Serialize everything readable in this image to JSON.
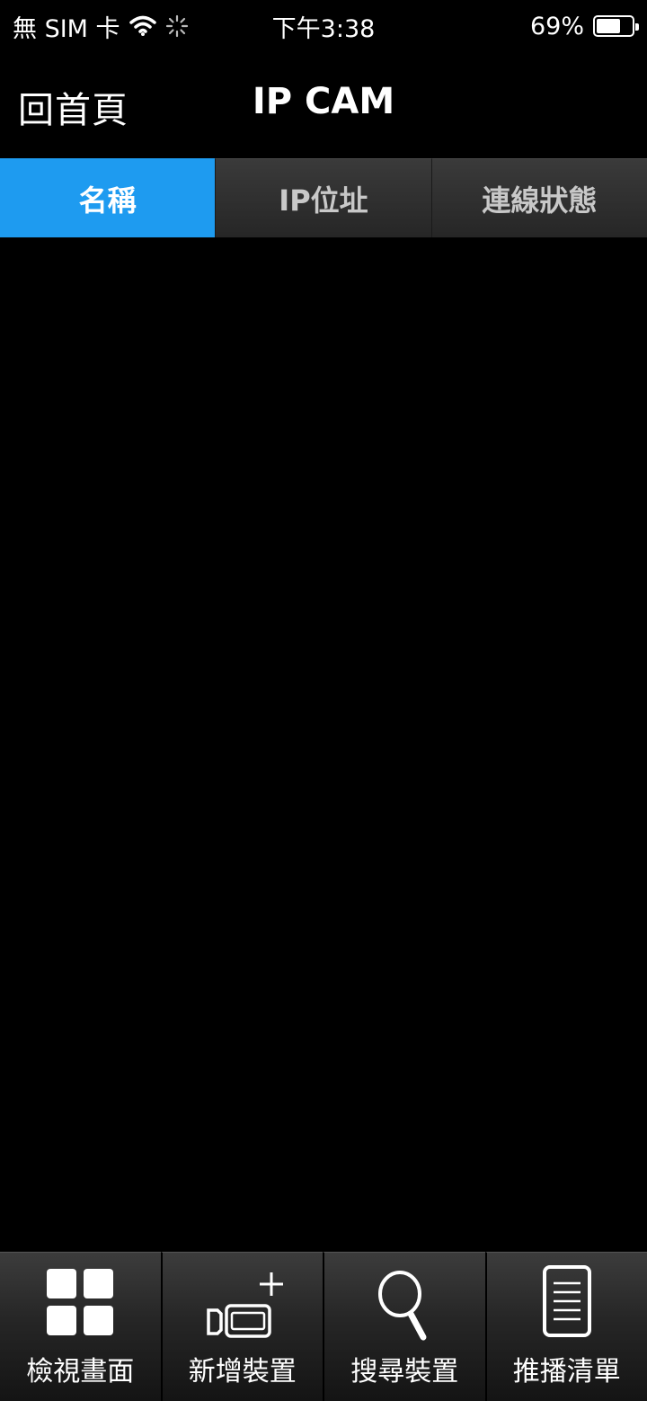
{
  "status_bar": {
    "carrier": "無 SIM 卡",
    "time": "下午3:38",
    "battery_text": "69%",
    "battery_level": 0.69
  },
  "nav": {
    "back_label": "回首頁",
    "title": "IP CAM"
  },
  "tabs": [
    {
      "label": "名稱",
      "active": true
    },
    {
      "label": "IP位址",
      "active": false
    },
    {
      "label": "連線狀態",
      "active": false
    }
  ],
  "toolbar": {
    "items": [
      {
        "label": "檢視畫面",
        "icon": "grid-icon"
      },
      {
        "label": "新增裝置",
        "icon": "add-camera-icon"
      },
      {
        "label": "搜尋裝置",
        "icon": "search-icon"
      },
      {
        "label": "推播清單",
        "icon": "list-icon"
      }
    ]
  },
  "colors": {
    "accent": "#1e9bf0",
    "background": "#000000"
  }
}
